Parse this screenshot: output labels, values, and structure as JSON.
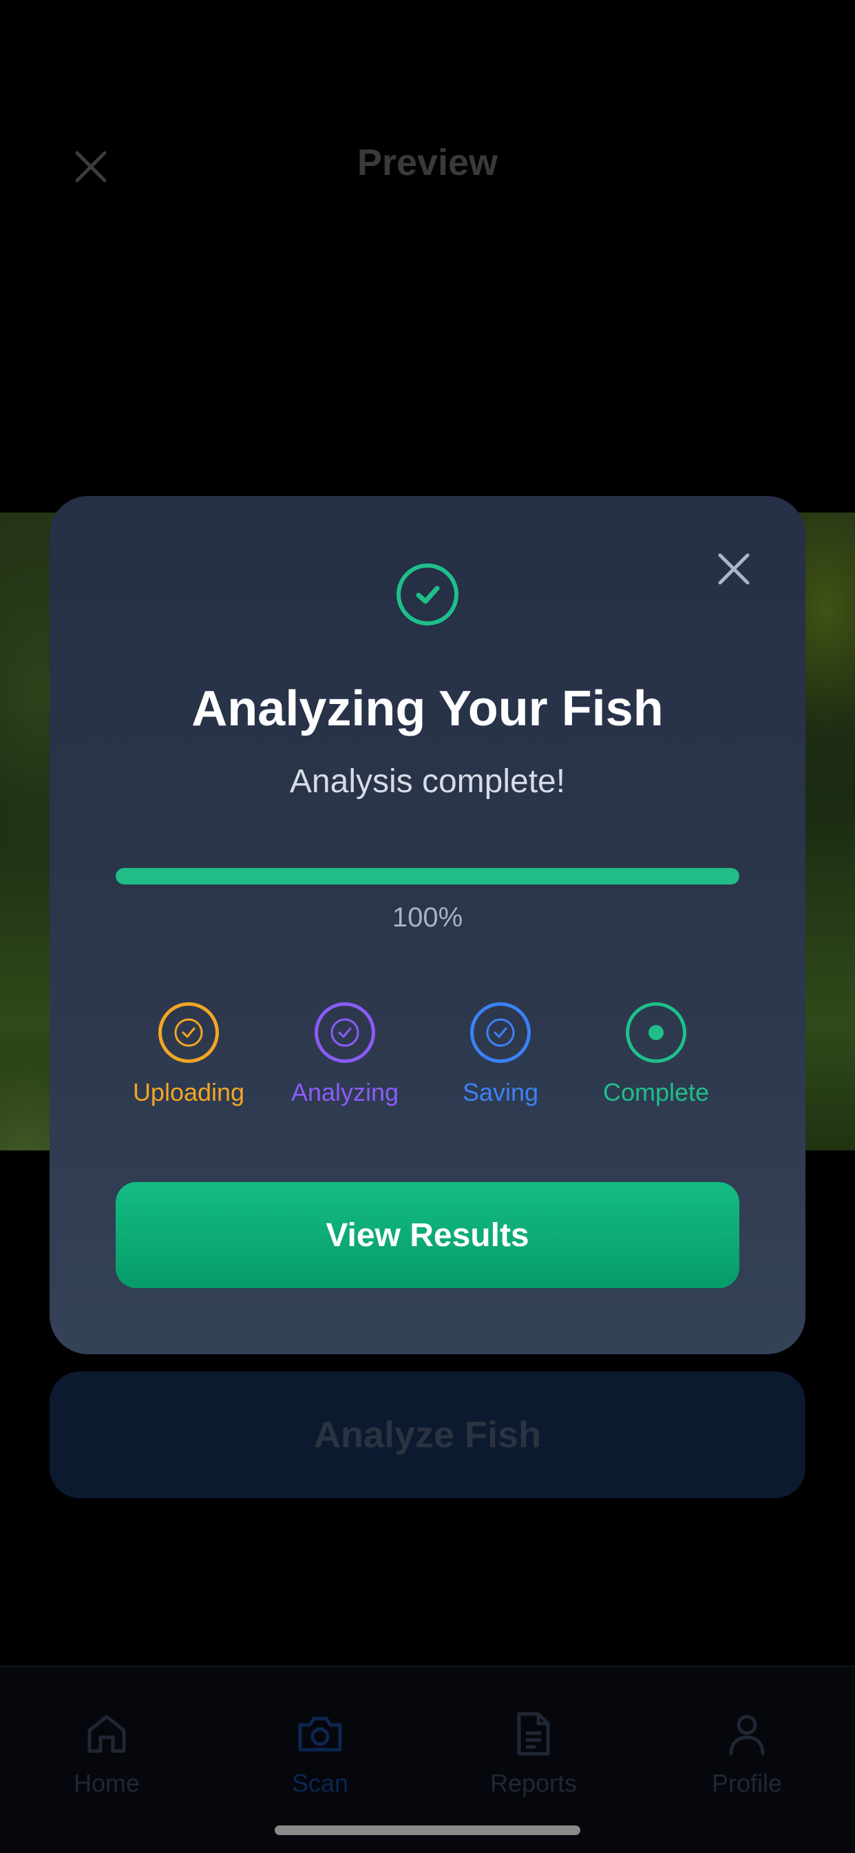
{
  "header": {
    "title": "Preview"
  },
  "modal": {
    "title": "Analyzing Your Fish",
    "subtitle": "Analysis complete!",
    "progress": {
      "fraction": 1.0,
      "label": "100%"
    },
    "steps": [
      {
        "label": "Uploading",
        "color": "#f5a623",
        "state": "done"
      },
      {
        "label": "Analyzing",
        "color": "#8b5cf6",
        "state": "done"
      },
      {
        "label": "Saving",
        "color": "#3b82f6",
        "state": "done"
      },
      {
        "label": "Complete",
        "color": "#1fbf8a",
        "state": "active"
      }
    ],
    "button_label": "View Results"
  },
  "analyze_button_label": "Analyze Fish",
  "tabs": [
    {
      "label": "Home",
      "icon": "home-icon"
    },
    {
      "label": "Scan",
      "icon": "camera-icon",
      "active": true
    },
    {
      "label": "Reports",
      "icon": "document-icon"
    },
    {
      "label": "Profile",
      "icon": "user-icon"
    }
  ],
  "colors": {
    "accent": "#22bd86",
    "modal_bg": "#2c374c"
  }
}
